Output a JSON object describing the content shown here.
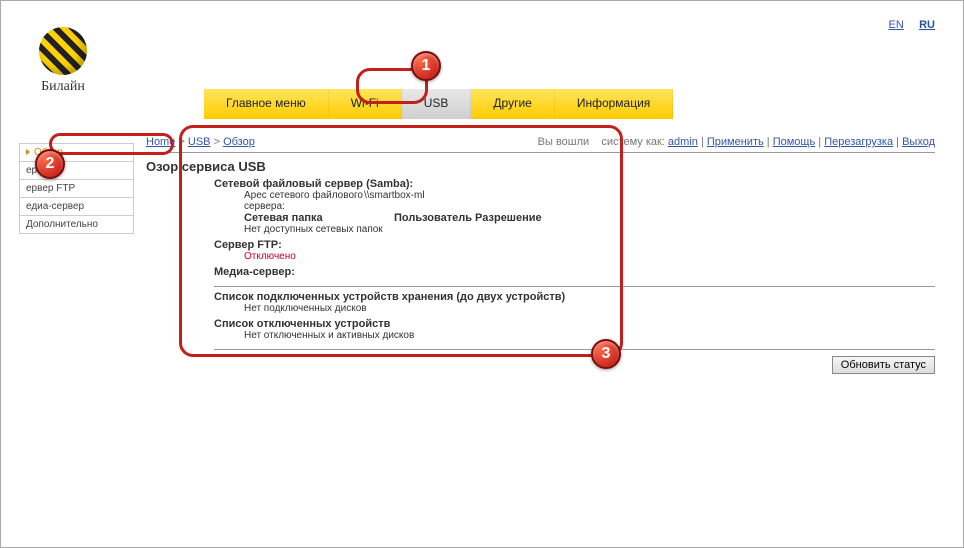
{
  "lang": {
    "en": "EN",
    "ru": "RU"
  },
  "brand": "Билайн",
  "nav": [
    {
      "label": "Главное меню"
    },
    {
      "label": "Wi-Fi"
    },
    {
      "label": "USB"
    },
    {
      "label": "Другие"
    },
    {
      "label": "Информация"
    }
  ],
  "sidebar": [
    {
      "label": "Обзор"
    },
    {
      "label": "ервер"
    },
    {
      "label": "ервер FTP"
    },
    {
      "label": "едиа-сервер"
    },
    {
      "label": "Дополнительно"
    }
  ],
  "breadcrumb": {
    "home": "Home",
    "usb": "USB",
    "overview": "Обзор",
    "sep": " > "
  },
  "login": {
    "prefix": "Вы вошли",
    "mid": " систему как: ",
    "admin": "admin",
    "apply": "Применить",
    "help": "Помощь",
    "reboot": "Перезагрузка",
    "logout": "Выход",
    "sep": " | "
  },
  "page": {
    "title": "Озор сервиса USB",
    "samba_title": "Сетевой файловый сервер (Samba):",
    "samba_addr_label": "Арес сетевого файлового сервера:",
    "samba_addr_val": "\\\\smartbox-ml",
    "net_folder": "Сетевая папка",
    "user_perm": "Пользователь Разрешение",
    "no_folders": "Нет доступных сетевых папок",
    "ftp_title": "Сервер FTP:",
    "ftp_status": "Отключено",
    "media_title": "Медиа-сервер:",
    "conn_title": "Список подключенных устройств хранения (до двух устройств)",
    "no_conn": "Нет подключенных дисков",
    "discon_title": "Список отключенных устройств",
    "no_discon": "Нет отключенных и активных дисков",
    "refresh": "Обновить статус"
  },
  "badges": {
    "b1": "1",
    "b2": "2",
    "b3": "3"
  }
}
